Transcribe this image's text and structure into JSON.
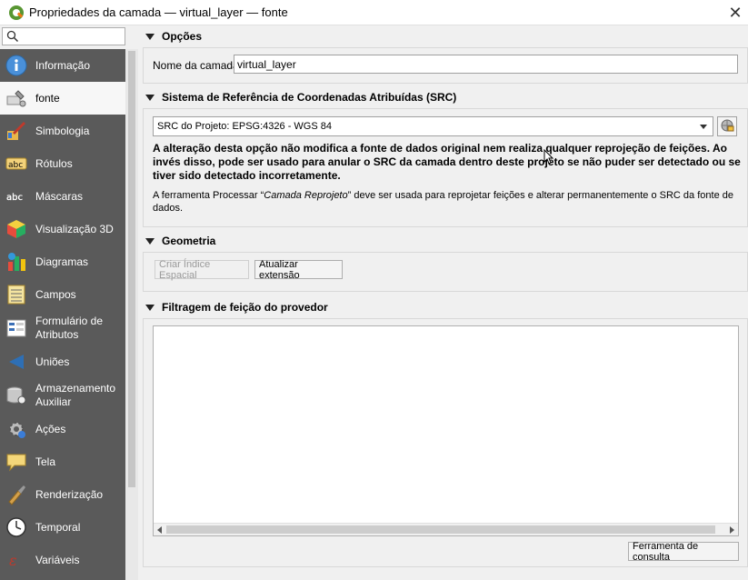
{
  "window": {
    "title": "Propriedades da camada — virtual_layer — fonte",
    "close_label": "✕"
  },
  "sidebar": {
    "search_placeholder": "",
    "items": [
      {
        "label": "Informação",
        "icon": "info-icon"
      },
      {
        "label": "fonte",
        "icon": "source-wrench-icon",
        "selected": true
      },
      {
        "label": "Simbologia",
        "icon": "symbology-brush-icon"
      },
      {
        "label": "Rótulos",
        "icon": "labels-abc-icon"
      },
      {
        "label": "Máscaras",
        "icon": "masks-abc-icon"
      },
      {
        "label": "Visualização 3D",
        "icon": "3d-cube-icon"
      },
      {
        "label": "Diagramas",
        "icon": "diagrams-icon"
      },
      {
        "label": "Campos",
        "icon": "fields-icon"
      },
      {
        "label": "Formulário de Atributos",
        "icon": "attributes-form-icon"
      },
      {
        "label": "Uniões",
        "icon": "joins-icon"
      },
      {
        "label": "Armazenamento Auxiliar",
        "icon": "auxiliary-storage-icon"
      },
      {
        "label": "Ações",
        "icon": "actions-gear-icon"
      },
      {
        "label": "Tela",
        "icon": "display-bubble-icon"
      },
      {
        "label": "Renderização",
        "icon": "rendering-brush-icon"
      },
      {
        "label": "Temporal",
        "icon": "temporal-clock-icon"
      },
      {
        "label": "Variáveis",
        "icon": "variables-icon"
      }
    ]
  },
  "main": {
    "options": {
      "header": "Opções",
      "layer_name_label": "Nome da camada",
      "layer_name_value": "virtual_layer"
    },
    "crs": {
      "header": "Sistema de Referência de Coordenadas Atribuídas (SRC)",
      "selected": "SRC do Projeto: EPSG:4326 - WGS 84",
      "warning_1": "A alteração desta opção não modifica a fonte de dados original nem realiza qualquer reprojeção de feições. Ao",
      "warning_2": "invés disso, pode ser usado para anular o SRC da camada dentro deste projeto se não puder ser detectado ou se",
      "warning_3": "tiver sido detectado incorretamente.",
      "info_prefix": "A ferramenta Processar “",
      "info_tool": "Camada Reprojeto",
      "info_suffix": "” deve ser usada para reprojetar feições e alterar permanentemente o SRC da fonte de",
      "info_line2": "dados."
    },
    "geometry": {
      "header": "Geometria",
      "create_index_button": "Criar Índice Espacial",
      "update_extent_button": "Atualizar extensão"
    },
    "filter": {
      "header": "Filtragem de feição do provedor",
      "query_builder_button": "Ferramenta de consulta"
    }
  },
  "colors": {
    "sidebar_bg": "#5a5a5a",
    "selected_bg": "#f7f7f7",
    "window_bg": "#f0f0f0"
  }
}
